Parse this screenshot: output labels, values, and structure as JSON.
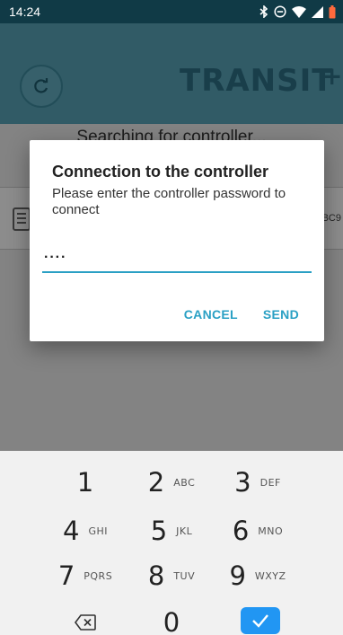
{
  "status_bar": {
    "time": "14:24"
  },
  "header": {
    "logo_text": "TRANSIT",
    "logo_plus": "+"
  },
  "main": {
    "search_status": "Searching for controller...",
    "device": {
      "serial": "FBC9"
    }
  },
  "dialog": {
    "title": "Connection to the controller",
    "message": "Please enter the controller password to connect",
    "password_value": "····",
    "cancel_label": "CANCEL",
    "send_label": "SEND"
  },
  "keypad": {
    "keys": [
      {
        "digit": "1",
        "letters": ""
      },
      {
        "digit": "2",
        "letters": "ABC"
      },
      {
        "digit": "3",
        "letters": "DEF"
      },
      {
        "digit": "4",
        "letters": "GHI"
      },
      {
        "digit": "5",
        "letters": "JKL"
      },
      {
        "digit": "6",
        "letters": "MNO"
      },
      {
        "digit": "7",
        "letters": "PQRS"
      },
      {
        "digit": "8",
        "letters": "TUV"
      },
      {
        "digit": "9",
        "letters": "WXYZ"
      },
      {
        "digit": "0",
        "letters": ""
      }
    ]
  },
  "icons": {
    "status": [
      "bluetooth-icon",
      "do-not-disturb-icon",
      "wifi-icon",
      "signal-icon",
      "battery-icon"
    ],
    "refresh": "refresh-icon",
    "device": "controller-icon",
    "backspace": "backspace-icon",
    "enter": "check-icon"
  },
  "colors": {
    "status_bar": "#103a46",
    "header": "#5aa6bb",
    "accent": "#2aa0c4",
    "enter_key": "#2196f3"
  }
}
